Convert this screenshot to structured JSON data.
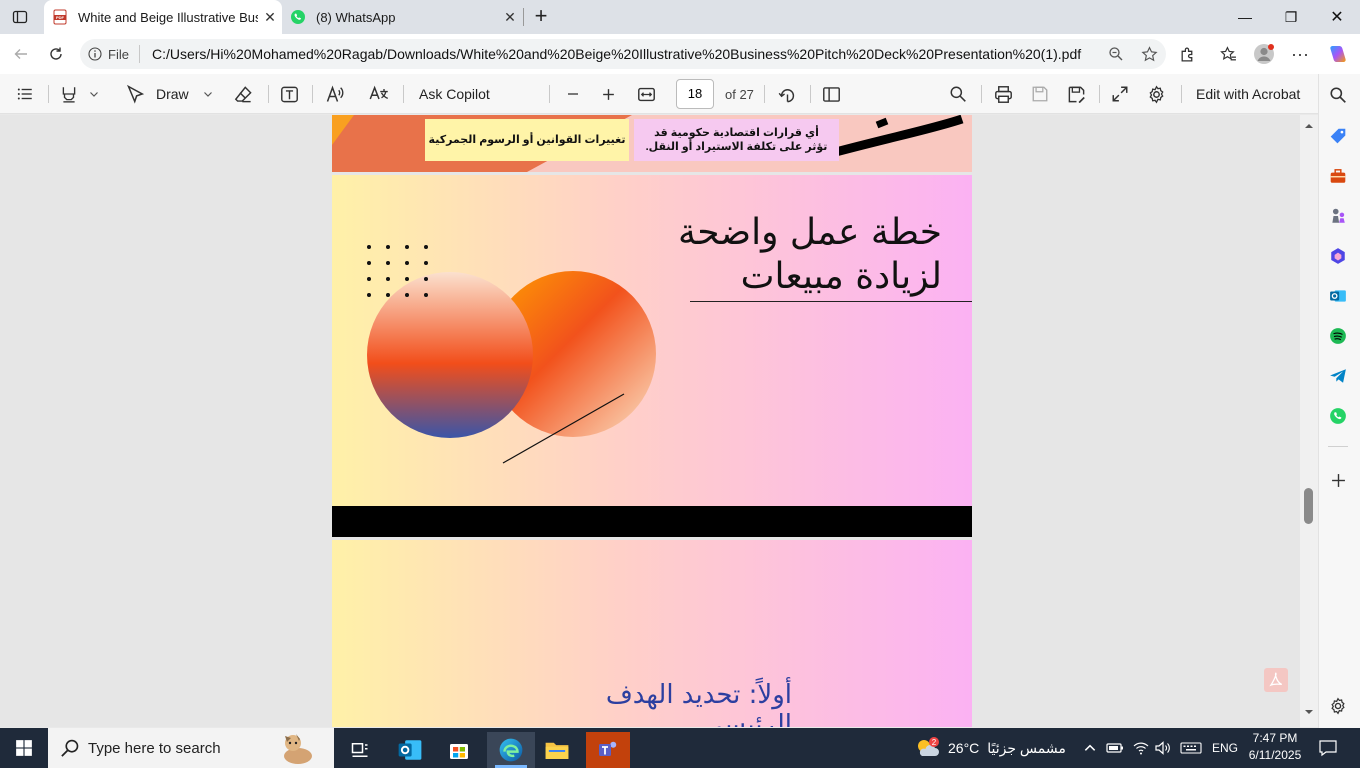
{
  "tabs": [
    {
      "label": "White and Beige Illustrative Busin",
      "close": "✕"
    },
    {
      "label": "(8) WhatsApp",
      "close": "✕"
    }
  ],
  "window": {
    "new_tab": "+",
    "minimize": "—",
    "restore": "❐",
    "close": "✕"
  },
  "address": {
    "file_chip": "File",
    "url": "C:/Users/Hi%20Mohamed%20Ragab/Downloads/White%20and%20Beige%20Illustrative%20Business%20Pitch%20Deck%20Presentation%20(1).pdf"
  },
  "pdf_toolbar": {
    "draw_label": "Draw",
    "ask_copilot": "Ask Copilot",
    "page_current": "18",
    "page_total": "of 27",
    "edit_acrobat": "Edit with Acrobat"
  },
  "slides": {
    "top_box_left": "تغييرات القوانين أو الرسوم الجمركية",
    "top_box_right": "أي قرارات اقتصادية حكومية قد تؤثر على تكلفة الاستيراد أو النقل.",
    "title_line1": "خطة عمل واضحة",
    "title_line2": "لزيادة مبيعات",
    "goal_text": "أولاً: تحديد الهدف الرئيسي"
  },
  "taskbar": {
    "search_placeholder": "Type here to search",
    "weather_temp": "26°C",
    "weather_desc": "مشمس جزئيًا",
    "weather_badge": "2",
    "lang": "ENG",
    "time": "7:47 PM",
    "date": "6/11/2025"
  },
  "colors": {
    "tab_active": "#ffffff",
    "tabbar_bg": "#dde1e7",
    "taskbar_bg": "#1f2a3a",
    "slide_gradient_start": "#fff1a8",
    "slide_gradient_end": "#fbb2f3"
  }
}
